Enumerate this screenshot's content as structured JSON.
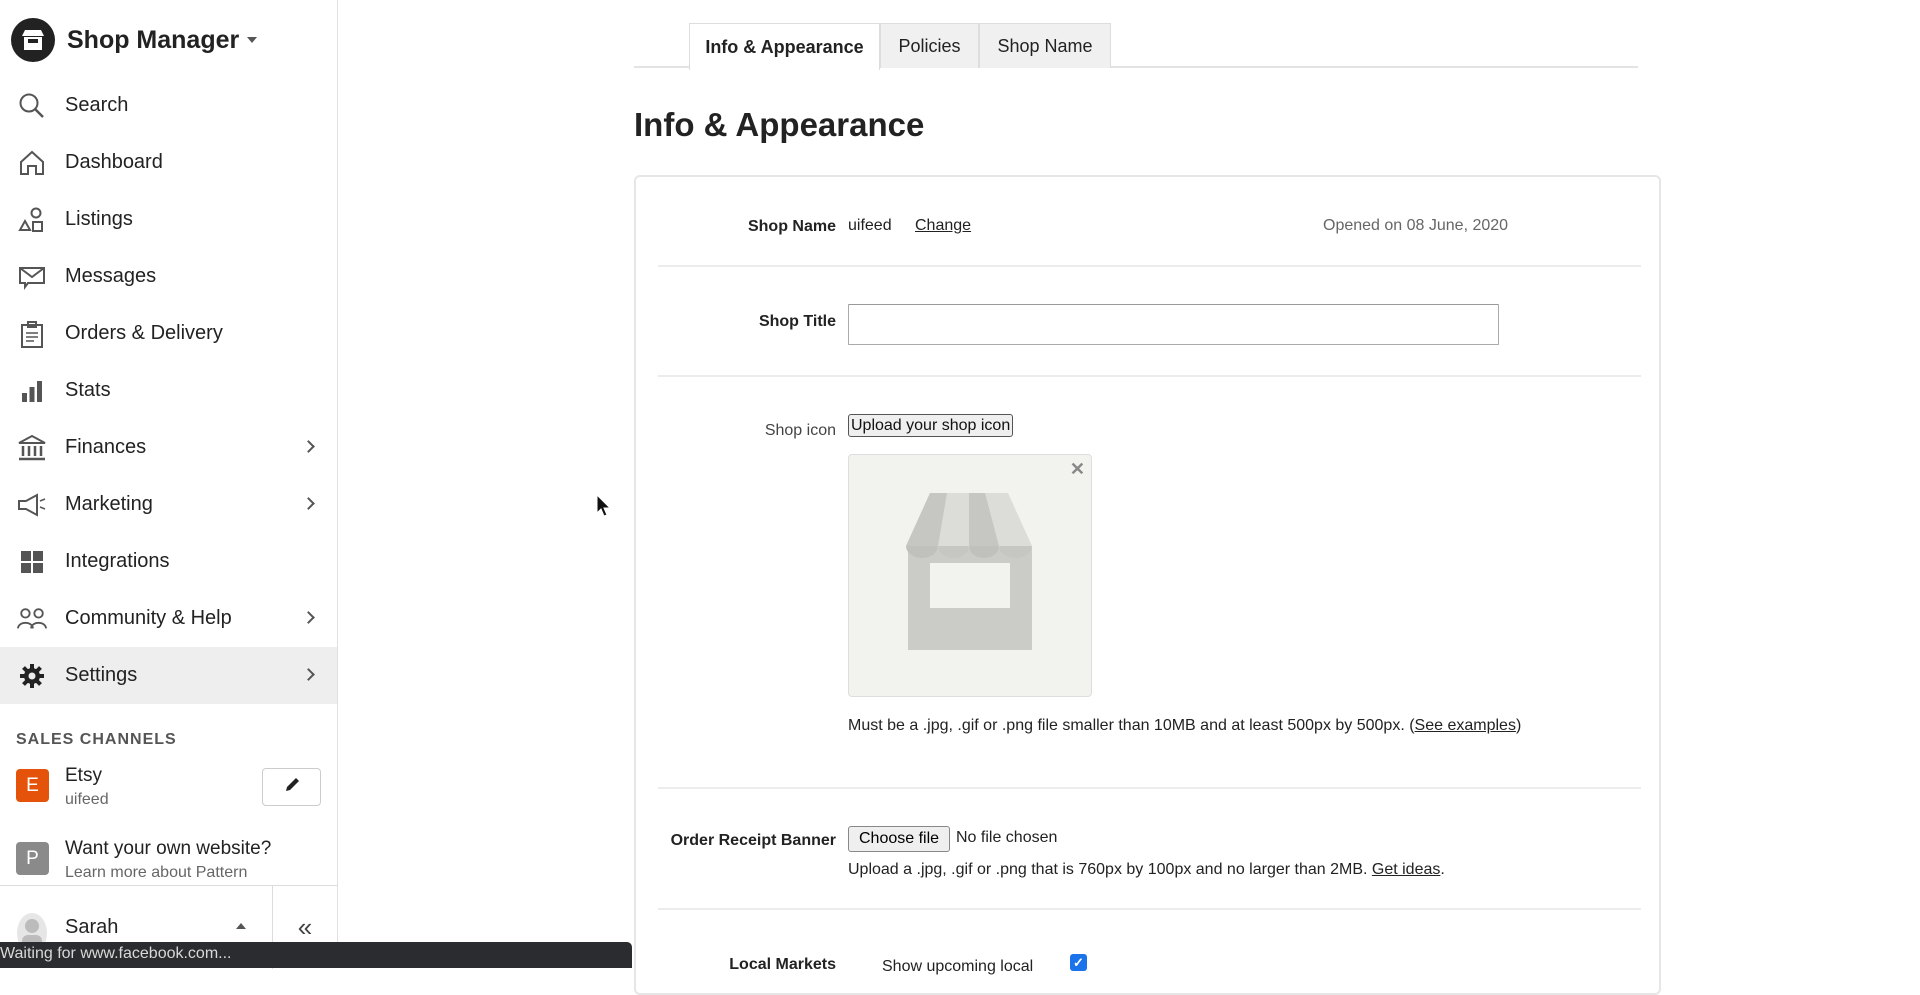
{
  "sidebar": {
    "brand_title": "Shop Manager",
    "nav": [
      {
        "label": "Search",
        "icon": "search-icon",
        "chevron": false,
        "active": false
      },
      {
        "label": "Dashboard",
        "icon": "home-icon",
        "chevron": false,
        "active": false
      },
      {
        "label": "Listings",
        "icon": "shapes-icon",
        "chevron": false,
        "active": false
      },
      {
        "label": "Messages",
        "icon": "envelope-icon",
        "chevron": false,
        "active": false
      },
      {
        "label": "Orders & Delivery",
        "icon": "clipboard-icon",
        "chevron": false,
        "active": false
      },
      {
        "label": "Stats",
        "icon": "bar-chart-icon",
        "chevron": false,
        "active": false
      },
      {
        "label": "Finances",
        "icon": "bank-icon",
        "chevron": true,
        "active": false
      },
      {
        "label": "Marketing",
        "icon": "megaphone-icon",
        "chevron": true,
        "active": false
      },
      {
        "label": "Integrations",
        "icon": "grid-icon",
        "chevron": false,
        "active": false
      },
      {
        "label": "Community & Help",
        "icon": "people-icon",
        "chevron": true,
        "active": false
      },
      {
        "label": "Settings",
        "icon": "gear-icon",
        "chevron": true,
        "active": true
      }
    ],
    "sales_channels_title": "SALES CHANNELS",
    "channels": [
      {
        "badge": "E",
        "badge_color": "#e5530b",
        "name": "Etsy",
        "sub": "uifeed"
      },
      {
        "badge": "P",
        "badge_color": "#8a8a8a",
        "name": "Want your own website?",
        "sub": "Learn more about Pattern"
      }
    ],
    "user_name": "Sarah",
    "collapse_symbol": "«"
  },
  "status_bar": "Waiting for www.facebook.com...",
  "tabs": [
    {
      "label": "Info & Appearance",
      "active": true
    },
    {
      "label": "Policies",
      "active": false
    },
    {
      "label": "Shop Name",
      "active": false
    }
  ],
  "page_title": "Info & Appearance",
  "form": {
    "shop_name": {
      "label": "Shop Name",
      "value": "uifeed",
      "change_link": "Change",
      "opened": "Opened on 08 June, 2020"
    },
    "shop_title": {
      "label": "Shop Title",
      "value": ""
    },
    "shop_icon": {
      "label": "Shop icon",
      "upload_button": "Upload your shop icon",
      "close_symbol": "✕",
      "help_text": "Must be a .jpg, .gif or .png file smaller than 10MB and at least 500px by 500px. (",
      "help_link": "See examples",
      "help_end": ")"
    },
    "order_receipt_banner": {
      "label": "Order Receipt Banner",
      "choose_file": "Choose file",
      "no_file": "No file chosen",
      "help_text": "Upload a .jpg, .gif or .png that is 760px by 100px and no larger than 2MB. ",
      "help_link": "Get ideas",
      "help_end": "."
    },
    "local_markets": {
      "label": "Local Markets",
      "option_text": "Show upcoming local",
      "checked": true
    }
  },
  "colors": {
    "accent_checkbox": "#1a73e8",
    "etsy": "#e5530b"
  }
}
